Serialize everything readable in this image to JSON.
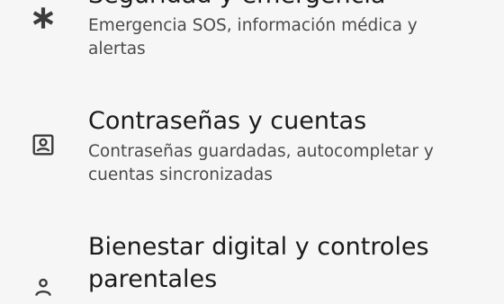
{
  "settings": {
    "items": [
      {
        "title": "Seguridad y emergencia",
        "subtitle": "Emergencia SOS, información médica y alertas",
        "icon": "asterisk-icon"
      },
      {
        "title": "Contraseñas y cuentas",
        "subtitle": "Contraseñas guardadas, autocompletar y cuentas sincronizadas",
        "icon": "account-box-icon"
      },
      {
        "title": "Bienestar digital y controles parentales",
        "subtitle": "",
        "icon": "person-icon"
      }
    ]
  },
  "colors": {
    "background": "#f6f6f6",
    "title": "#1b1b1b",
    "subtitle": "#4a4a4a",
    "icon": "#444444"
  }
}
